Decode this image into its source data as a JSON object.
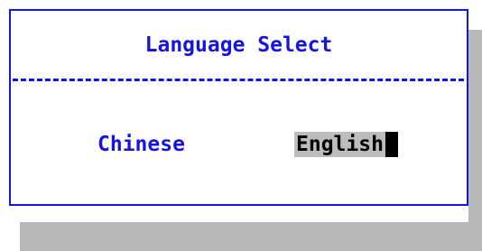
{
  "dialog": {
    "title": "Language Select",
    "options": [
      {
        "label": "Chinese",
        "selected": false
      },
      {
        "label": "English",
        "selected": true
      }
    ]
  },
  "colors": {
    "accent": "#1414e6",
    "selection": "#bdbdbd",
    "shadow": "#b8b8b8"
  }
}
